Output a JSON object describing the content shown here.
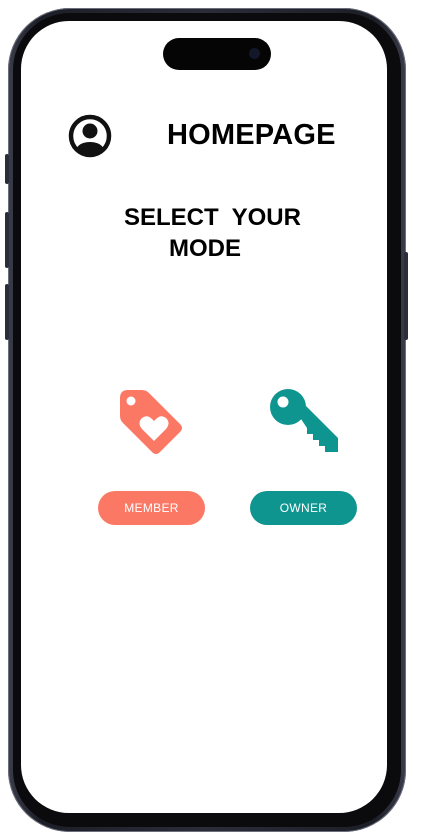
{
  "app": {
    "title": "HOMEPAGE",
    "subtitle_line1": "SELECT  YOUR",
    "subtitle_line2": "MODE"
  },
  "modes": {
    "member": {
      "label": "MEMBER",
      "icon": "heart-tag-icon",
      "color": "#FB7865"
    },
    "owner": {
      "label": "OWNER",
      "icon": "key-icon",
      "color": "#0F958F"
    }
  },
  "header": {
    "profile_icon": "profile-icon"
  }
}
